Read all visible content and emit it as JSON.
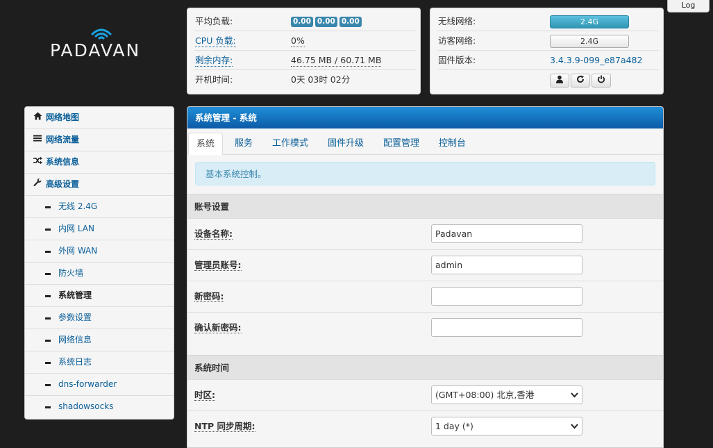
{
  "log_tab": "Log",
  "logo": {
    "text": "PADAVAN"
  },
  "status_left": {
    "rows": [
      {
        "label": "平均负载:",
        "badges": [
          "0.00",
          "0.00",
          "0.00"
        ]
      },
      {
        "label": "CPU 负载:",
        "value": "0%"
      },
      {
        "label": "剩余内存:",
        "value": "46.75 MB / 60.71 MB"
      },
      {
        "label": "开机时间:",
        "value": "0天 03时 02分"
      }
    ]
  },
  "status_right": {
    "wireless_label": "无线网络:",
    "wireless_btn": "2.4G",
    "guest_label": "访客网络:",
    "guest_btn": "2.4G",
    "firmware_label": "固件版本:",
    "firmware_value": "3.4.3.9-099_e87a482",
    "icons": [
      "user-icon",
      "refresh-icon",
      "power-icon"
    ]
  },
  "sidebar": {
    "top_items": [
      {
        "label": "网络地图",
        "icon": "home-icon"
      },
      {
        "label": "网络流量",
        "icon": "list-icon"
      },
      {
        "label": "系统信息",
        "icon": "shuffle-icon"
      },
      {
        "label": "高级设置",
        "icon": "wrench-icon"
      }
    ],
    "sub_items": [
      {
        "label": "无线 2.4G"
      },
      {
        "label": "内网 LAN"
      },
      {
        "label": "外网 WAN"
      },
      {
        "label": "防火墙"
      },
      {
        "label": "系统管理"
      },
      {
        "label": "参数设置"
      },
      {
        "label": "网络信息"
      },
      {
        "label": "系统日志"
      },
      {
        "label": "dns-forwarder"
      },
      {
        "label": "shadowsocks"
      }
    ]
  },
  "main": {
    "title": "系统管理 - 系统",
    "tabs": [
      "系统",
      "服务",
      "工作模式",
      "固件升级",
      "配置管理",
      "控制台"
    ],
    "alert": "基本系统控制。",
    "section_account": "账号设置",
    "device_name_label": "设备名称:",
    "device_name_value": "Padavan",
    "admin_label": "管理员账号:",
    "admin_value": "admin",
    "new_pw_label": "新密码:",
    "new_pw_value": "",
    "confirm_pw_label": "确认新密码:",
    "confirm_pw_value": "",
    "section_time": "系统时间",
    "timezone_label": "时区:",
    "timezone_value": "(GMT+08:00) 北京,香港",
    "ntp_label": "NTP 同步周期:",
    "ntp_value": "1 day (*)"
  },
  "colors": {
    "accent": "#0a5f99",
    "header": "#0c5aa6",
    "badge": "#3a87ad",
    "alert_bg": "#d9edf7"
  }
}
